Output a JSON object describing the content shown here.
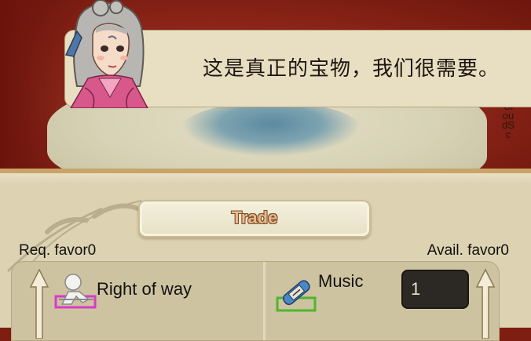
{
  "dialog": {
    "text": "这是真正的宝物，我们很需要。",
    "side_text": "CloudSc"
  },
  "trade": {
    "title": "Trade",
    "req_favor_label": "Req. favor",
    "req_favor_value": "0",
    "avail_favor_label": "Avail. favor",
    "avail_favor_value": "0",
    "left_item": {
      "label": "Right of way",
      "icon": "right-of-way-icon"
    },
    "right_item": {
      "label": "Music",
      "icon": "music-scroll-icon",
      "quantity": "1"
    }
  },
  "colors": {
    "map_red": "#8a2418",
    "panel": "#ddd3b2",
    "dialog": "#e8dfc2",
    "title_text": "#e8b98c",
    "right_of_way_frame": "#d63cc8",
    "music_frame": "#4fb531"
  }
}
